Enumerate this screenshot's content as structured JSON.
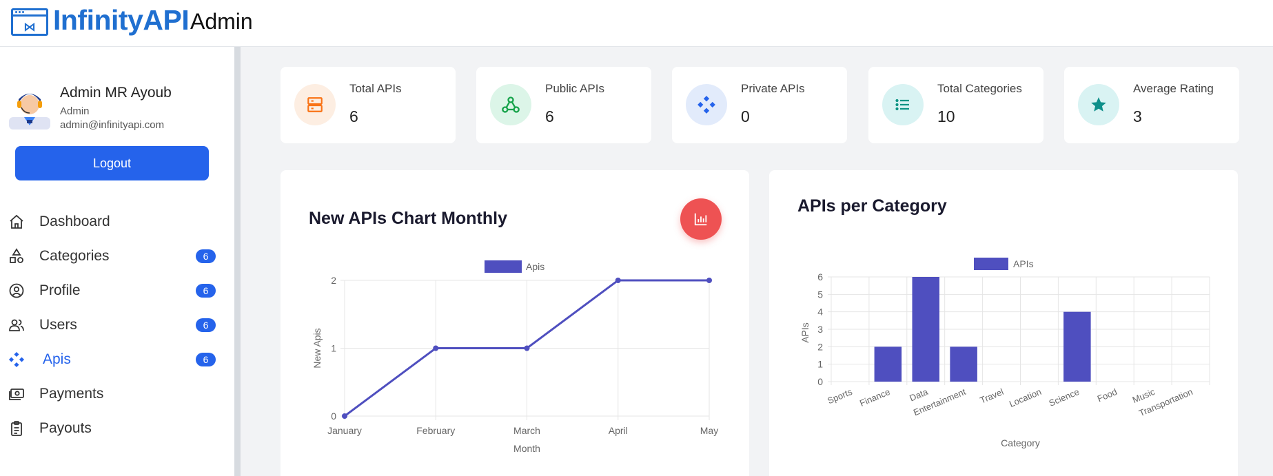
{
  "header": {
    "brand": "InfinityAPI",
    "section": "Admin"
  },
  "user": {
    "name": "Admin MR Ayoub",
    "role": "Admin",
    "email": "admin@infinityapi.com",
    "logout_label": "Logout"
  },
  "nav": {
    "items": [
      {
        "label": "Dashboard",
        "icon": "home-icon",
        "badge": ""
      },
      {
        "label": "Categories",
        "icon": "shapes-icon",
        "badge": "6"
      },
      {
        "label": "Profile",
        "icon": "user-circle-icon",
        "badge": "6"
      },
      {
        "label": "Users",
        "icon": "users-icon",
        "badge": "6"
      },
      {
        "label": "Apis",
        "icon": "api-diamond-icon",
        "badge": "6",
        "active": true
      },
      {
        "label": "Payments",
        "icon": "money-icon",
        "badge": ""
      },
      {
        "label": "Payouts",
        "icon": "clipboard-icon",
        "badge": ""
      }
    ]
  },
  "stats": [
    {
      "label": "Total APIs",
      "value": "6",
      "icon": "server-icon",
      "color": "#f97316",
      "bg": "#fdeee2"
    },
    {
      "label": "Public APIs",
      "value": "6",
      "icon": "webhook-icon",
      "color": "#16a34a",
      "bg": "#dcf5e8"
    },
    {
      "label": "Private APIs",
      "value": "0",
      "icon": "api-diamond-icon",
      "color": "#2563eb",
      "bg": "#e2ebfb"
    },
    {
      "label": "Total Categories",
      "value": "10",
      "icon": "list-icon",
      "color": "#0e9384",
      "bg": "#d9f3f3"
    },
    {
      "label": "Average Rating",
      "value": "3",
      "icon": "star-icon",
      "color": "#0e8f8a",
      "bg": "#d9f3f3"
    }
  ],
  "colors": {
    "accent": "#2563eb",
    "series": "#4f4fbf",
    "fab": "#ee5253"
  },
  "chart_data": [
    {
      "type": "line",
      "title": "New APIs Chart Monthly",
      "x": [
        "January",
        "February",
        "March",
        "April",
        "May"
      ],
      "series": [
        {
          "name": "Apis",
          "values": [
            0,
            1,
            1,
            2,
            2
          ]
        }
      ],
      "xlabel": "Month",
      "ylabel": "New Apis",
      "ylim": [
        0,
        2
      ],
      "yticks": [
        "0",
        "1",
        "2"
      ],
      "grid": true,
      "legend": "top"
    },
    {
      "type": "bar",
      "title": "APIs per Category",
      "categories": [
        "Sports",
        "Finance",
        "Data",
        "Entertainment",
        "Travel",
        "Location",
        "Science",
        "Food",
        "Music",
        "Transportation"
      ],
      "series": [
        {
          "name": "APIs",
          "values": [
            0,
            2,
            6,
            2,
            0,
            0,
            4,
            0,
            0,
            0
          ]
        }
      ],
      "xlabel": "Category",
      "ylabel": "APIs",
      "ylim": [
        0,
        6
      ],
      "yticks": [
        "0",
        "1",
        "2",
        "3",
        "4",
        "5",
        "6"
      ],
      "grid": true,
      "legend": "top"
    }
  ]
}
